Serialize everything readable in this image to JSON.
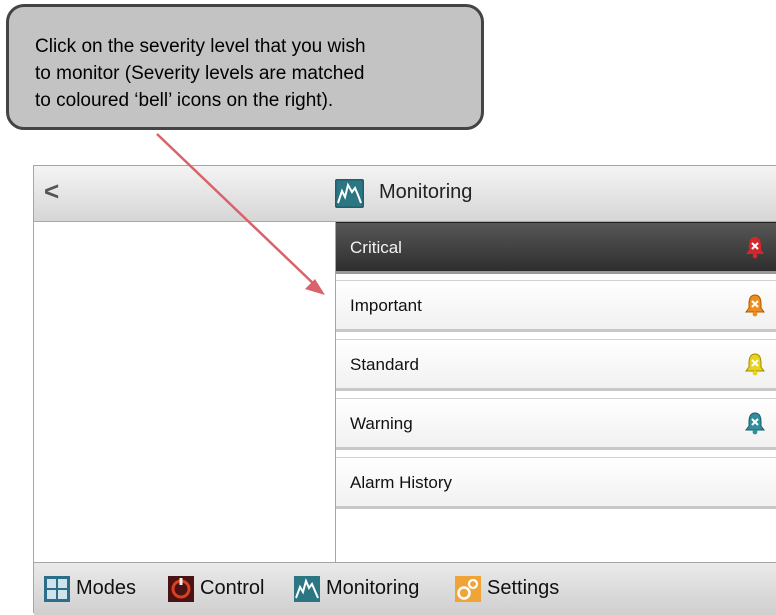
{
  "callout": {
    "lines": [
      "Click on the severity level that you wish",
      "to monitor (Severity levels are matched",
      "to coloured ‘bell’ icons on the right)."
    ]
  },
  "header": {
    "back_label": "<",
    "title": "Monitoring",
    "title_icon": "monitoring-icon"
  },
  "menu": {
    "items": [
      {
        "label": "Critical",
        "icon": "bell-critical-icon",
        "color": "#d6262b",
        "active": true
      },
      {
        "label": "Important",
        "icon": "bell-important-icon",
        "color": "#f08c1c"
      },
      {
        "label": "Standard",
        "icon": "bell-standard-icon",
        "color": "#e8d21d"
      },
      {
        "label": "Warning",
        "icon": "bell-warning-icon",
        "color": "#2f8f9e"
      },
      {
        "label": "Alarm History"
      }
    ]
  },
  "footer": {
    "nav": [
      {
        "label": "Modes",
        "icon": "modes-icon"
      },
      {
        "label": "Control",
        "icon": "control-icon"
      },
      {
        "label": "Monitoring",
        "icon": "monitoring-icon"
      },
      {
        "label": "Settings",
        "icon": "settings-icon"
      }
    ]
  }
}
